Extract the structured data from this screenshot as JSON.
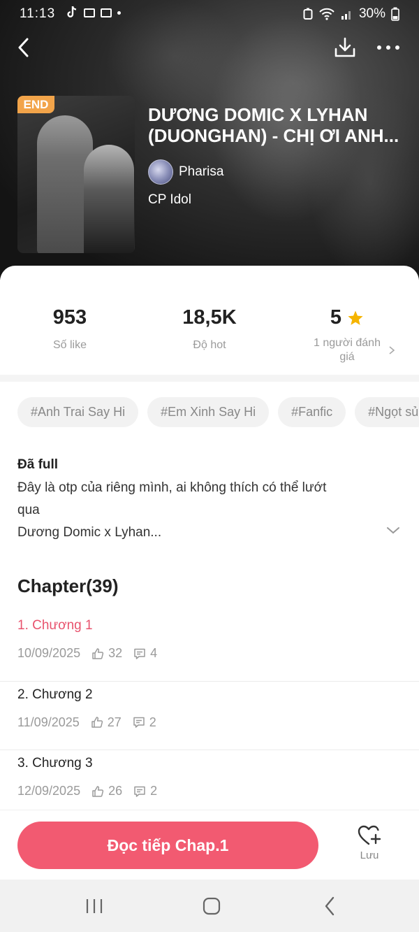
{
  "status_bar": {
    "time": "11:13",
    "battery": "30%"
  },
  "header": {
    "badge": "END",
    "title_line1": "DƯƠNG DOMIC X LYHAN",
    "title_line2": "(DUONGHAN) - CHỊ ƠI ANH...",
    "author": "Pharisa",
    "category": "CP Idol"
  },
  "stats": [
    {
      "value": "953",
      "label": "Số like"
    },
    {
      "value": "18,5K",
      "label": "Độ hot"
    },
    {
      "value": "5",
      "label": "1 người đánh giá"
    }
  ],
  "tags": [
    "#Anh Trai Say Hi",
    "#Em Xinh Say Hi",
    "#Fanfic",
    "#Ngọt sủ"
  ],
  "description": {
    "status": "Đã full",
    "text_line1": "Đây là otp của riêng mình, ai không thích có thể lướt",
    "text_line2": "qua",
    "text_line3": "Dương Domic x Lyhan..."
  },
  "chapters_header": "Chapter(39)",
  "chapters": [
    {
      "title": "1. Chương 1",
      "date": "10/09/2025",
      "likes": "32",
      "comments": "4",
      "active": true
    },
    {
      "title": "2. Chương 2",
      "date": "11/09/2025",
      "likes": "27",
      "comments": "2",
      "active": false
    },
    {
      "title": "3. Chương 3",
      "date": "12/09/2025",
      "likes": "26",
      "comments": "2",
      "active": false
    }
  ],
  "actions": {
    "read_button": "Đọc tiếp Chap.1",
    "save_label": "Lưu"
  },
  "colors": {
    "accent": "#f25a71",
    "active_chapter": "#e8536e",
    "badge": "#f2a44a",
    "star": "#f5b400"
  },
  "icons": {
    "back": "back-arrow-icon",
    "download": "download-icon",
    "more": "more-dots-icon",
    "star": "star-icon",
    "like": "thumbs-up-icon",
    "comment": "comment-icon",
    "save": "heart-plus-icon"
  }
}
